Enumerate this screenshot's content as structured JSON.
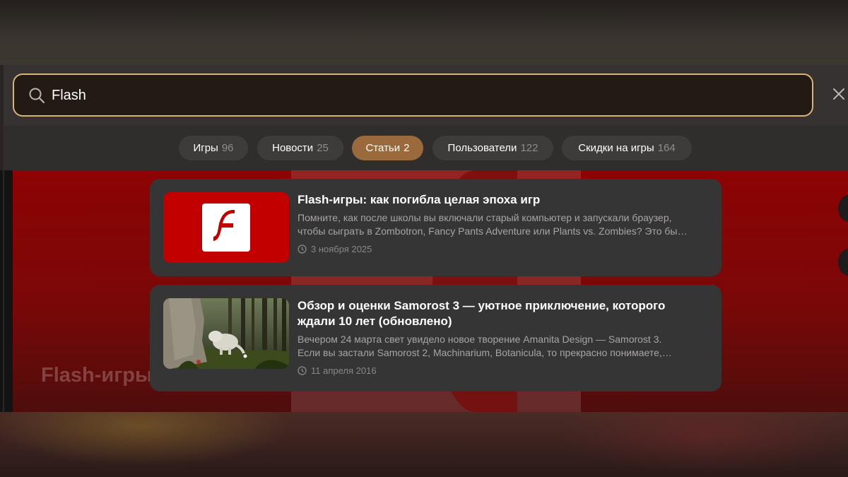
{
  "search": {
    "query": "Flash"
  },
  "tabs": [
    {
      "label": "Игры",
      "count": "96"
    },
    {
      "label": "Новости",
      "count": "25"
    },
    {
      "label": "Статьи",
      "count": "2"
    },
    {
      "label": "Пользователи",
      "count": "122"
    },
    {
      "label": "Скидки на игры",
      "count": "164"
    }
  ],
  "active_tab": "Статьи",
  "results": [
    {
      "title": "Flash-игры: как погибла целая эпоха игр",
      "excerpt_line1": "Помните, как после школы вы включали старый компьютер и запускали браузер,",
      "excerpt_line2": "чтобы сыграть в Zombotron, Fancy Pants Adventure или Plants vs. Zombies? Это бы…",
      "date": "3 ноября 2025",
      "thumbnail": "flash-player-logo"
    },
    {
      "title_line1": "Обзор и оценки Samorost 3 — уютное приключение, которого",
      "title_line2": "ждали 10 лет (обновлено)",
      "excerpt_line1": "Вечером 24 марта свет увидело новое творение Amanita Design — Samorost 3.",
      "excerpt_line2": "Если вы застали Samorost 2, Machinarium, Botanicula, то прекрасно понимаете,…",
      "date": "11 апреля 2016",
      "thumbnail": "samorost-forest-scene"
    }
  ],
  "background": {
    "title": "Flash-игры"
  },
  "colors": {
    "accent": "#d8b27d",
    "active_tab": "#9a6a3c",
    "flash_red": "#c20000"
  }
}
